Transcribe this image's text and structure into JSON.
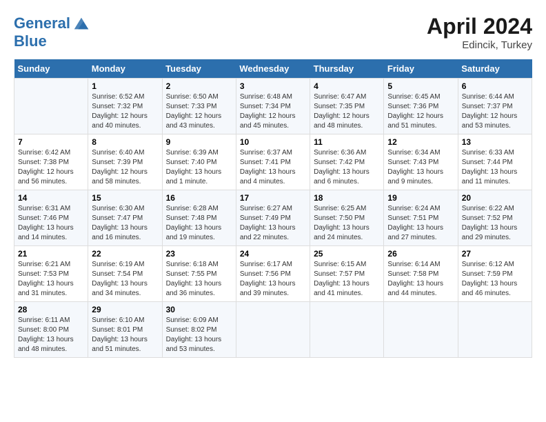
{
  "logo": {
    "line1": "General",
    "line2": "Blue"
  },
  "header": {
    "month": "April 2024",
    "location": "Edincik, Turkey"
  },
  "weekdays": [
    "Sunday",
    "Monday",
    "Tuesday",
    "Wednesday",
    "Thursday",
    "Friday",
    "Saturday"
  ],
  "weeks": [
    [
      {
        "day": "",
        "sunrise": "",
        "sunset": "",
        "daylight": ""
      },
      {
        "day": "1",
        "sunrise": "Sunrise: 6:52 AM",
        "sunset": "Sunset: 7:32 PM",
        "daylight": "Daylight: 12 hours and 40 minutes."
      },
      {
        "day": "2",
        "sunrise": "Sunrise: 6:50 AM",
        "sunset": "Sunset: 7:33 PM",
        "daylight": "Daylight: 12 hours and 43 minutes."
      },
      {
        "day": "3",
        "sunrise": "Sunrise: 6:48 AM",
        "sunset": "Sunset: 7:34 PM",
        "daylight": "Daylight: 12 hours and 45 minutes."
      },
      {
        "day": "4",
        "sunrise": "Sunrise: 6:47 AM",
        "sunset": "Sunset: 7:35 PM",
        "daylight": "Daylight: 12 hours and 48 minutes."
      },
      {
        "day": "5",
        "sunrise": "Sunrise: 6:45 AM",
        "sunset": "Sunset: 7:36 PM",
        "daylight": "Daylight: 12 hours and 51 minutes."
      },
      {
        "day": "6",
        "sunrise": "Sunrise: 6:44 AM",
        "sunset": "Sunset: 7:37 PM",
        "daylight": "Daylight: 12 hours and 53 minutes."
      }
    ],
    [
      {
        "day": "7",
        "sunrise": "Sunrise: 6:42 AM",
        "sunset": "Sunset: 7:38 PM",
        "daylight": "Daylight: 12 hours and 56 minutes."
      },
      {
        "day": "8",
        "sunrise": "Sunrise: 6:40 AM",
        "sunset": "Sunset: 7:39 PM",
        "daylight": "Daylight: 12 hours and 58 minutes."
      },
      {
        "day": "9",
        "sunrise": "Sunrise: 6:39 AM",
        "sunset": "Sunset: 7:40 PM",
        "daylight": "Daylight: 13 hours and 1 minute."
      },
      {
        "day": "10",
        "sunrise": "Sunrise: 6:37 AM",
        "sunset": "Sunset: 7:41 PM",
        "daylight": "Daylight: 13 hours and 4 minutes."
      },
      {
        "day": "11",
        "sunrise": "Sunrise: 6:36 AM",
        "sunset": "Sunset: 7:42 PM",
        "daylight": "Daylight: 13 hours and 6 minutes."
      },
      {
        "day": "12",
        "sunrise": "Sunrise: 6:34 AM",
        "sunset": "Sunset: 7:43 PM",
        "daylight": "Daylight: 13 hours and 9 minutes."
      },
      {
        "day": "13",
        "sunrise": "Sunrise: 6:33 AM",
        "sunset": "Sunset: 7:44 PM",
        "daylight": "Daylight: 13 hours and 11 minutes."
      }
    ],
    [
      {
        "day": "14",
        "sunrise": "Sunrise: 6:31 AM",
        "sunset": "Sunset: 7:46 PM",
        "daylight": "Daylight: 13 hours and 14 minutes."
      },
      {
        "day": "15",
        "sunrise": "Sunrise: 6:30 AM",
        "sunset": "Sunset: 7:47 PM",
        "daylight": "Daylight: 13 hours and 16 minutes."
      },
      {
        "day": "16",
        "sunrise": "Sunrise: 6:28 AM",
        "sunset": "Sunset: 7:48 PM",
        "daylight": "Daylight: 13 hours and 19 minutes."
      },
      {
        "day": "17",
        "sunrise": "Sunrise: 6:27 AM",
        "sunset": "Sunset: 7:49 PM",
        "daylight": "Daylight: 13 hours and 22 minutes."
      },
      {
        "day": "18",
        "sunrise": "Sunrise: 6:25 AM",
        "sunset": "Sunset: 7:50 PM",
        "daylight": "Daylight: 13 hours and 24 minutes."
      },
      {
        "day": "19",
        "sunrise": "Sunrise: 6:24 AM",
        "sunset": "Sunset: 7:51 PM",
        "daylight": "Daylight: 13 hours and 27 minutes."
      },
      {
        "day": "20",
        "sunrise": "Sunrise: 6:22 AM",
        "sunset": "Sunset: 7:52 PM",
        "daylight": "Daylight: 13 hours and 29 minutes."
      }
    ],
    [
      {
        "day": "21",
        "sunrise": "Sunrise: 6:21 AM",
        "sunset": "Sunset: 7:53 PM",
        "daylight": "Daylight: 13 hours and 31 minutes."
      },
      {
        "day": "22",
        "sunrise": "Sunrise: 6:19 AM",
        "sunset": "Sunset: 7:54 PM",
        "daylight": "Daylight: 13 hours and 34 minutes."
      },
      {
        "day": "23",
        "sunrise": "Sunrise: 6:18 AM",
        "sunset": "Sunset: 7:55 PM",
        "daylight": "Daylight: 13 hours and 36 minutes."
      },
      {
        "day": "24",
        "sunrise": "Sunrise: 6:17 AM",
        "sunset": "Sunset: 7:56 PM",
        "daylight": "Daylight: 13 hours and 39 minutes."
      },
      {
        "day": "25",
        "sunrise": "Sunrise: 6:15 AM",
        "sunset": "Sunset: 7:57 PM",
        "daylight": "Daylight: 13 hours and 41 minutes."
      },
      {
        "day": "26",
        "sunrise": "Sunrise: 6:14 AM",
        "sunset": "Sunset: 7:58 PM",
        "daylight": "Daylight: 13 hours and 44 minutes."
      },
      {
        "day": "27",
        "sunrise": "Sunrise: 6:12 AM",
        "sunset": "Sunset: 7:59 PM",
        "daylight": "Daylight: 13 hours and 46 minutes."
      }
    ],
    [
      {
        "day": "28",
        "sunrise": "Sunrise: 6:11 AM",
        "sunset": "Sunset: 8:00 PM",
        "daylight": "Daylight: 13 hours and 48 minutes."
      },
      {
        "day": "29",
        "sunrise": "Sunrise: 6:10 AM",
        "sunset": "Sunset: 8:01 PM",
        "daylight": "Daylight: 13 hours and 51 minutes."
      },
      {
        "day": "30",
        "sunrise": "Sunrise: 6:09 AM",
        "sunset": "Sunset: 8:02 PM",
        "daylight": "Daylight: 13 hours and 53 minutes."
      },
      {
        "day": "",
        "sunrise": "",
        "sunset": "",
        "daylight": ""
      },
      {
        "day": "",
        "sunrise": "",
        "sunset": "",
        "daylight": ""
      },
      {
        "day": "",
        "sunrise": "",
        "sunset": "",
        "daylight": ""
      },
      {
        "day": "",
        "sunrise": "",
        "sunset": "",
        "daylight": ""
      }
    ]
  ]
}
